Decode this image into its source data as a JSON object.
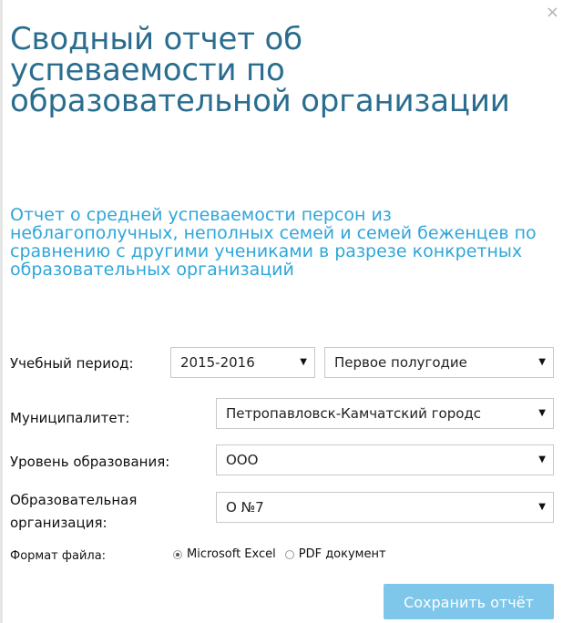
{
  "dialog": {
    "close_glyph": "×",
    "title": "Сводный отчет об успеваемости по образовательной организации",
    "subtitle": "Отчет о средней успеваемости персон из неблагополучных, неполных семей и семей беженцев по сравнению с другими учениками в разрезе конкретных образовательных организаций"
  },
  "form": {
    "period_label": "Учебный период:",
    "period_year": "2015-2016",
    "period_term": "Первое полугодие",
    "municipality_label": "Муниципалитет:",
    "municipality_value": "Петропавловск-Камчатский городс",
    "level_label": "Уровень образования:",
    "level_value": "ООО",
    "org_label_line1": "Образовательная",
    "org_label_line2": "организация:",
    "org_value": "О №7",
    "format_label": "Формат файла:",
    "format_options": [
      "Microsoft Excel",
      "PDF документ"
    ],
    "selected_format": "Microsoft Excel",
    "caret_glyph": "▼",
    "save_label": "Сохранить отчёт"
  }
}
